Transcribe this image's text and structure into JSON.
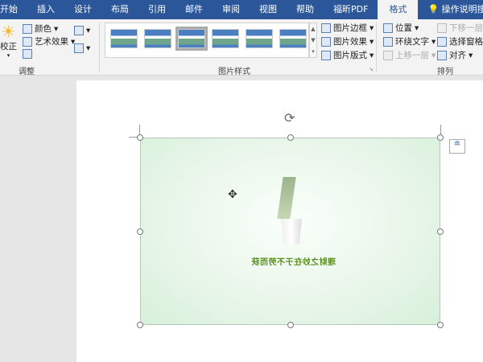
{
  "tabs": [
    "开始",
    "插入",
    "设计",
    "布局",
    "引用",
    "邮件",
    "审阅",
    "视图",
    "帮助",
    "福昕PDF",
    "格式"
  ],
  "tell_me": "操作说明搜索",
  "adjust": {
    "correct": "校正",
    "color": "颜色",
    "artistic": "艺术效果",
    "label": "调整"
  },
  "styles": {
    "label": "图片样式",
    "border": "图片边框",
    "effects": "图片效果",
    "layout": "图片版式"
  },
  "arrange": {
    "position": "位置",
    "wrap": "环绕文字",
    "forward": "上移一层",
    "backward": "下移一层",
    "pane": "选择窗格",
    "align": "对齐",
    "label": "排列"
  },
  "picture": {
    "caption": "理财之妙在于不劳而获"
  }
}
